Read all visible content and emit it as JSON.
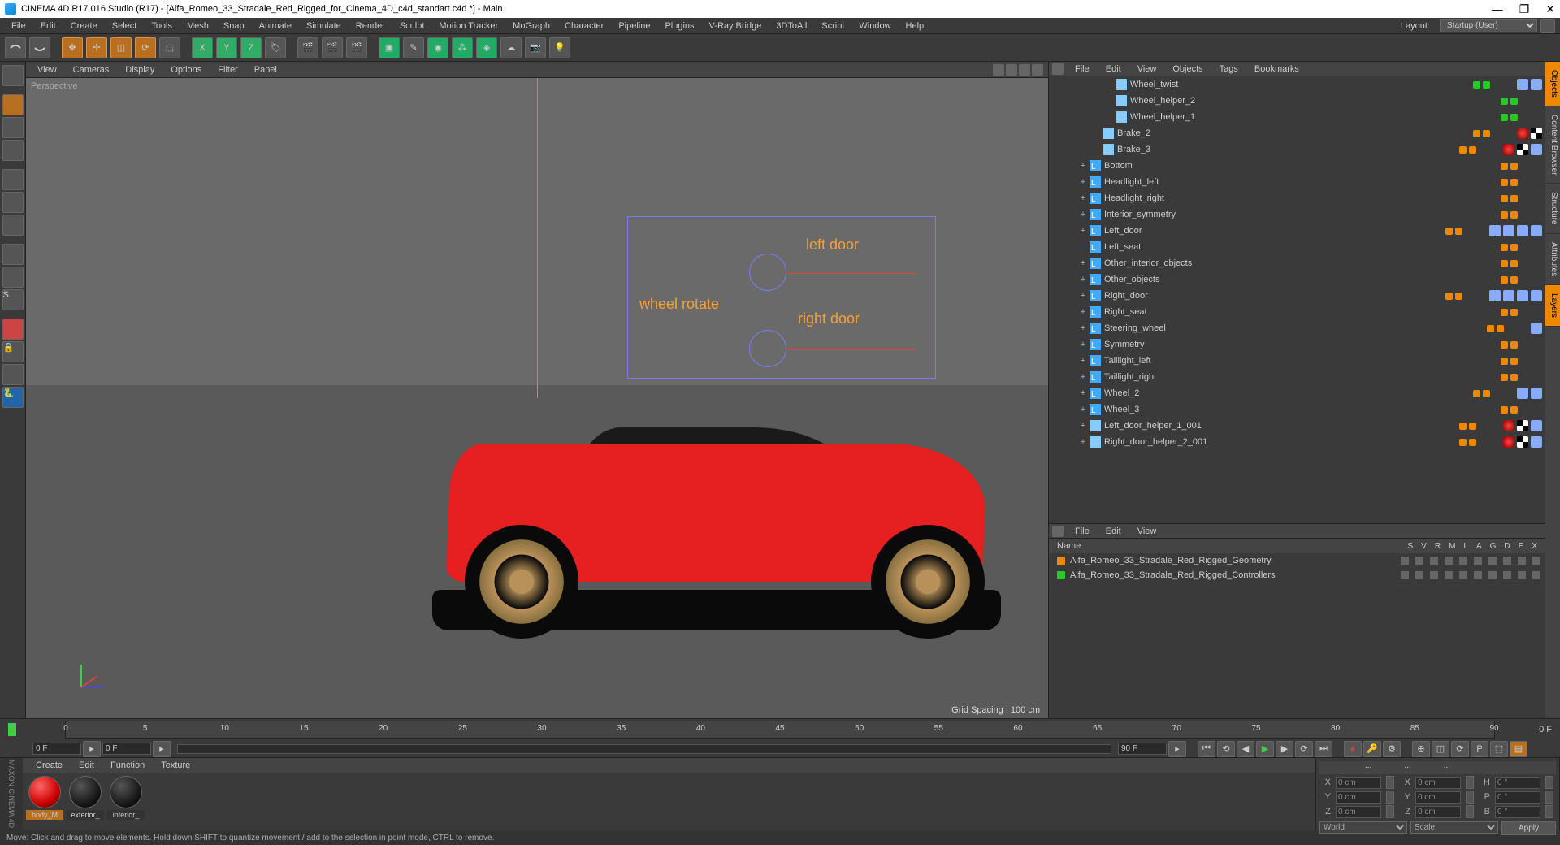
{
  "title": "CINEMA 4D R17.016 Studio (R17) - [Alfa_Romeo_33_Stradale_Red_Rigged_for_Cinema_4D_c4d_standart.c4d *] - Main",
  "menubar": [
    "File",
    "Edit",
    "Create",
    "Select",
    "Tools",
    "Mesh",
    "Snap",
    "Animate",
    "Simulate",
    "Render",
    "Sculpt",
    "Motion Tracker",
    "MoGraph",
    "Character",
    "Pipeline",
    "Plugins",
    "V-Ray Bridge",
    "3DToAll",
    "Script",
    "Window",
    "Help"
  ],
  "layout_label": "Layout:",
  "layout_value": "Startup (User)",
  "vpmenu": [
    "View",
    "Cameras",
    "Display",
    "Options",
    "Filter",
    "Panel"
  ],
  "vp_label": "Perspective",
  "grid_spacing": "Grid Spacing : 100 cm",
  "annot": {
    "left_door": "left door",
    "right_door": "right door",
    "wheel_rotate": "wheel rotate"
  },
  "obj_menu": [
    "File",
    "Edit",
    "View",
    "Objects",
    "Tags",
    "Bookmarks"
  ],
  "objects": [
    {
      "indent": 3,
      "exp": "",
      "icon": "poly",
      "name": "Wheel_twist",
      "dots": [
        "g",
        "g"
      ],
      "tags": [
        "xp1",
        "xp2"
      ]
    },
    {
      "indent": 3,
      "exp": "",
      "icon": "poly",
      "name": "Wheel_helper_2",
      "dots": [
        "g",
        "g"
      ],
      "tags": []
    },
    {
      "indent": 3,
      "exp": "",
      "icon": "poly",
      "name": "Wheel_helper_1",
      "dots": [
        "g",
        "g"
      ],
      "tags": []
    },
    {
      "indent": 2,
      "exp": "",
      "icon": "poly",
      "name": "Brake_2",
      "dots": [
        "o",
        "o"
      ],
      "tags": [
        "tex",
        "chk"
      ]
    },
    {
      "indent": 2,
      "exp": "",
      "icon": "poly",
      "name": "Brake_3",
      "dots": [
        "o",
        "o"
      ],
      "tags": [
        "tex",
        "chk",
        "t2"
      ]
    },
    {
      "indent": 1,
      "exp": "+",
      "icon": "null",
      "name": "Bottom",
      "dots": [
        "o",
        "o"
      ],
      "tags": []
    },
    {
      "indent": 1,
      "exp": "+",
      "icon": "null",
      "name": "Headlight_left",
      "dots": [
        "o",
        "o"
      ],
      "tags": []
    },
    {
      "indent": 1,
      "exp": "+",
      "icon": "null",
      "name": "Headlight_right",
      "dots": [
        "o",
        "o"
      ],
      "tags": []
    },
    {
      "indent": 1,
      "exp": "+",
      "icon": "null",
      "name": "Interior_symmetry",
      "dots": [
        "o",
        "o"
      ],
      "tags": []
    },
    {
      "indent": 1,
      "exp": "+",
      "icon": "null",
      "name": "Left_door",
      "dots": [
        "o",
        "o"
      ],
      "tags": [
        "xp1",
        "xp2",
        "xp3",
        "xp4"
      ]
    },
    {
      "indent": 1,
      "exp": "",
      "icon": "null",
      "name": "Left_seat",
      "dots": [
        "o",
        "o"
      ],
      "tags": []
    },
    {
      "indent": 1,
      "exp": "+",
      "icon": "null",
      "name": "Other_interior_objects",
      "dots": [
        "o",
        "o"
      ],
      "tags": []
    },
    {
      "indent": 1,
      "exp": "+",
      "icon": "null",
      "name": "Other_objects",
      "dots": [
        "o",
        "o"
      ],
      "tags": []
    },
    {
      "indent": 1,
      "exp": "+",
      "icon": "null",
      "name": "Right_door",
      "dots": [
        "o",
        "o"
      ],
      "tags": [
        "xp1",
        "xp2",
        "xp3",
        "xp4"
      ]
    },
    {
      "indent": 1,
      "exp": "+",
      "icon": "null",
      "name": "Right_seat",
      "dots": [
        "o",
        "o"
      ],
      "tags": []
    },
    {
      "indent": 1,
      "exp": "+",
      "icon": "null",
      "name": "Steering_wheel",
      "dots": [
        "o",
        "o"
      ],
      "tags": [
        "xp1"
      ]
    },
    {
      "indent": 1,
      "exp": "+",
      "icon": "null",
      "name": "Symmetry",
      "dots": [
        "o",
        "o"
      ],
      "tags": []
    },
    {
      "indent": 1,
      "exp": "+",
      "icon": "null",
      "name": "Taillight_left",
      "dots": [
        "o",
        "o"
      ],
      "tags": []
    },
    {
      "indent": 1,
      "exp": "+",
      "icon": "null",
      "name": "Taillight_right",
      "dots": [
        "o",
        "o"
      ],
      "tags": []
    },
    {
      "indent": 1,
      "exp": "+",
      "icon": "null",
      "name": "Wheel_2",
      "dots": [
        "o",
        "o"
      ],
      "tags": [
        "xp1",
        "xp2"
      ]
    },
    {
      "indent": 1,
      "exp": "+",
      "icon": "null",
      "name": "Wheel_3",
      "dots": [
        "o",
        "o"
      ],
      "tags": []
    },
    {
      "indent": 1,
      "exp": "+",
      "icon": "poly",
      "name": "Left_door_helper_1_001",
      "dots": [
        "o",
        "o"
      ],
      "tags": [
        "tex",
        "chk",
        "t2"
      ]
    },
    {
      "indent": 1,
      "exp": "+",
      "icon": "poly",
      "name": "Right_door_helper_2_001",
      "dots": [
        "o",
        "o"
      ],
      "tags": [
        "tex",
        "chk",
        "t2"
      ]
    }
  ],
  "lay_menu": [
    "File",
    "Edit",
    "View"
  ],
  "lay_header": "Name",
  "lay_cols": [
    "S",
    "V",
    "R",
    "M",
    "L",
    "A",
    "G",
    "D",
    "E",
    "X"
  ],
  "layers": [
    {
      "color": "#e80",
      "name": "Alfa_Romeo_33_Stradale_Red_Rigged_Geometry"
    },
    {
      "color": "#2c2",
      "name": "Alfa_Romeo_33_Stradale_Red_Rigged_Controllers"
    }
  ],
  "sidetabs": [
    "Objects",
    "Content Browser",
    "Structure",
    "Attributes",
    "Layers"
  ],
  "timeline": {
    "ticks": [
      0,
      5,
      10,
      15,
      20,
      25,
      30,
      35,
      40,
      45,
      50,
      55,
      60,
      65,
      70,
      75,
      80,
      85,
      90
    ],
    "end_label": "0 F",
    "start": "0 F",
    "goStart": "0 F",
    "goEnd": "90 F"
  },
  "mat_menu": [
    "Create",
    "Edit",
    "Function",
    "Texture"
  ],
  "materials": [
    {
      "name": "body_M",
      "color": "radial-gradient(circle at 35% 30%,#f66,#c00 60%,#400)"
    },
    {
      "name": "exterior_",
      "color": "radial-gradient(circle at 35% 30%,#555,#111 70%)"
    },
    {
      "name": "interior_",
      "color": "radial-gradient(circle at 35% 30%,#555,#111 70%)"
    }
  ],
  "coord": {
    "headers": [
      "...",
      "...",
      "..."
    ],
    "rows": [
      {
        "l": "X",
        "v1": "0 cm",
        "l2": "X",
        "v2": "0 cm",
        "l3": "H",
        "v3": "0 °"
      },
      {
        "l": "Y",
        "v1": "0 cm",
        "l2": "Y",
        "v2": "0 cm",
        "l3": "P",
        "v3": "0 °"
      },
      {
        "l": "Z",
        "v1": "0 cm",
        "l2": "Z",
        "v2": "0 cm",
        "l3": "B",
        "v3": "0 °"
      }
    ],
    "world": "World",
    "scale": "Scale",
    "apply": "Apply"
  },
  "status": "Move: Click and drag to move elements. Hold down SHIFT to quantize movement / add to the selection in point mode, CTRL to remove."
}
